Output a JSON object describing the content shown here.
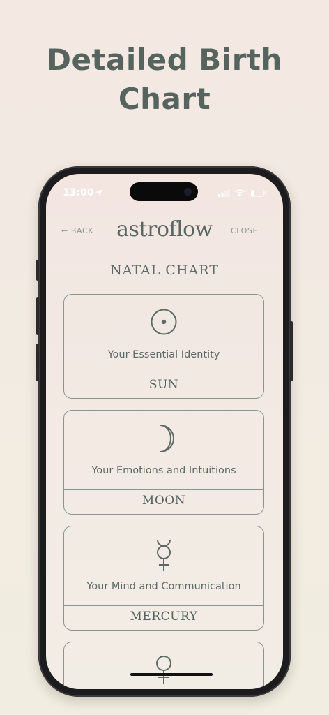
{
  "headline": {
    "line1": "Detailed Birth",
    "line2": "Chart"
  },
  "status_bar": {
    "time": "13:00"
  },
  "nav": {
    "back_label": "← BACK",
    "close_label": "CLOSE",
    "logo_text": "astroflow"
  },
  "section_title": "NATAL CHART",
  "cards": [
    {
      "name": "SUN",
      "description": "Your Essential Identity",
      "icon": "sun-icon"
    },
    {
      "name": "MOON",
      "description": "Your Emotions and Intuitions",
      "icon": "moon-icon"
    },
    {
      "name": "MERCURY",
      "description": "Your Mind and Communication",
      "icon": "mercury-icon"
    },
    {
      "name": "",
      "description": "",
      "icon": "venus-icon"
    }
  ],
  "colors": {
    "primary": "#56635f",
    "line": "#8a9590",
    "background": "#f2ebe3"
  }
}
